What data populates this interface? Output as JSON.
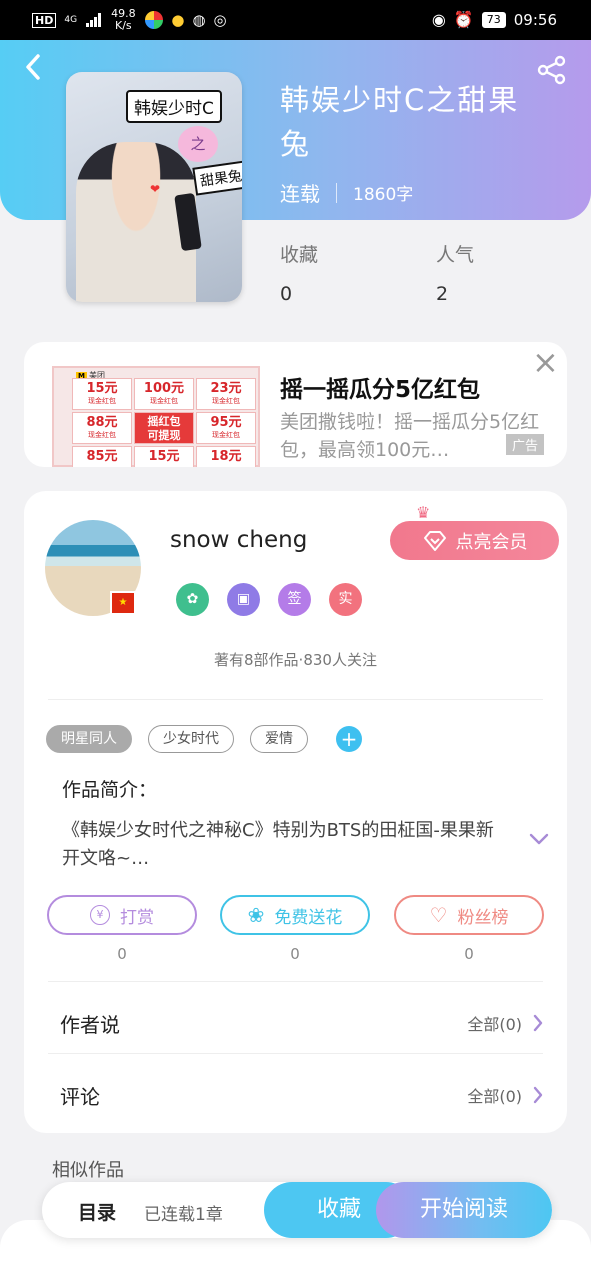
{
  "status_bar": {
    "hd": "HD",
    "network": "4G",
    "speed_value": "49.8",
    "speed_unit": "K/s",
    "battery": "73",
    "time": "09:56"
  },
  "header": {
    "back_label": "‹",
    "title": "韩娱少时C之甜果兔",
    "status": "连载",
    "word_count": "1860字",
    "cover_text_top": "韩娱少时C",
    "cover_text_mid": "之",
    "cover_text_bottom": "甜果兔",
    "stats": [
      {
        "label": "收藏",
        "value": "0"
      },
      {
        "label": "人气",
        "value": "2"
      }
    ]
  },
  "ad": {
    "brand": "美团",
    "tiles": [
      {
        "amount": "15元",
        "sub": "现金红包"
      },
      {
        "amount": "100元",
        "sub": "现金红包"
      },
      {
        "amount": "23元",
        "sub": "现金红包"
      },
      {
        "amount": "88元",
        "sub": "现金红包"
      },
      {
        "amount": "摇红包",
        "sub": "可提现"
      },
      {
        "amount": "95元",
        "sub": "现金红包"
      },
      {
        "amount": "85元",
        "sub": ""
      },
      {
        "amount": "15元",
        "sub": ""
      },
      {
        "amount": "18元",
        "sub": ""
      }
    ],
    "title": "摇一摇瓜分5亿红包",
    "description": "美团撒钱啦！摇一摇瓜分5亿红包，最高领100元…",
    "close_label": "×",
    "badge": "广告"
  },
  "author": {
    "name": "snow cheng",
    "vip_button": "点亮会员",
    "badges": [
      {
        "icon": "handshake-icon",
        "glyph": "✿",
        "color": "#3fbf8e"
      },
      {
        "icon": "calendar-icon",
        "glyph": "▣",
        "color": "#8f7be6"
      },
      {
        "icon": "sign-icon",
        "glyph": "签",
        "color": "#b47ce8"
      },
      {
        "icon": "verified-icon",
        "glyph": "实",
        "color": "#f2727e"
      }
    ],
    "stats_text": "著有8部作品·830人关注"
  },
  "tags": [
    "明星同人",
    "少女时代",
    "爱情"
  ],
  "tag_add_label": "+",
  "intro": {
    "label": "作品简介：",
    "text": "《韩娱少女时代之神秘C》特别为BTS的田柾国-果果新开文咯~…"
  },
  "actions": [
    {
      "label": "打赏",
      "count": "0",
      "color": "#b48cde",
      "icon": "yen-icon",
      "glyph": "¥"
    },
    {
      "label": "免费送花",
      "count": "0",
      "color": "#3fc3e6",
      "icon": "flower-icon",
      "glyph": "❀"
    },
    {
      "label": "粉丝榜",
      "count": "0",
      "color": "#ef8a83",
      "icon": "fan-icon",
      "glyph": "♡"
    }
  ],
  "rows": [
    {
      "title": "作者说",
      "right": "全部(0)"
    },
    {
      "title": "评论",
      "right": "全部(0)"
    }
  ],
  "similar_label": "相似作品",
  "bottom_bar": {
    "toc": "目录",
    "chapters": "已连载1章",
    "favorite": "收藏",
    "read": "开始阅读"
  }
}
